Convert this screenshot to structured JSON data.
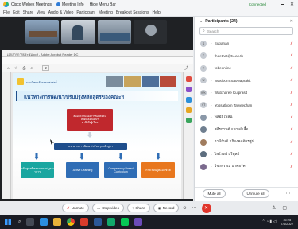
{
  "window": {
    "app_title": "Cisco Webex Meetings",
    "meeting_info": "Meeting Info",
    "hide_menu": "Hide Menu Bar",
    "status": "Connected"
  },
  "menu": [
    "File",
    "Edit",
    "Share",
    "View",
    "Audio & Video",
    "Participant",
    "Meeting",
    "Breakout Sessions",
    "Help"
  ],
  "pdf": {
    "tab_title": "เอกสารการประชุม.pdf - Adobe Acrobat Reader DC",
    "zoom_value": "2"
  },
  "slide": {
    "logo_text": "มหาวิทยาลัยธรรมศาสตร์",
    "heading": "แนวทางการพัฒนา/ปรับปรุงหลักสูตรของคณะฯ",
    "top_box": [
      "สนองความต้องการของสังคม",
      "สอดคล้องแผนฯ",
      "คำนึงถึงผู้เรียน"
    ],
    "middle_bar": "แนวทางการพัฒนา/ปรับปรุงหลักสูตร",
    "bottom_boxes": [
      "หลักสูตรที่หลากหลาย/บูรณาการ",
      "Active Learning",
      "Competency Based Curriculum",
      "การเรียนรู้ตลอดชีวิต"
    ]
  },
  "participants": {
    "title": "Participants (24)",
    "search_placeholder": "Search",
    "list": [
      {
        "initial": "S",
        "name": "Supanan"
      },
      {
        "initial": "T",
        "name": "theethat@tu.ac.th"
      },
      {
        "initial": "T",
        "name": "tobeonline"
      },
      {
        "initial": "W",
        "name": "Wasiporn  Saowaprakit"
      },
      {
        "initial": "WK",
        "name": "Watcharee Kulprasit"
      },
      {
        "initial": "YT",
        "name": "Yossathorn Taweephan"
      },
      {
        "initial": "",
        "name": "พลอยไพลิน"
      },
      {
        "initial": "",
        "name": "ศจีรกานต์ แหวนผีเสื้อ"
      },
      {
        "initial": "",
        "name": "อานีกันต์ อภิมงคลอัครศูน์"
      },
      {
        "initial": "",
        "name": "ไพโรจน์ บรีพูลย์"
      },
      {
        "initial": "",
        "name": "วิชรพรรณ นาคอร์ค"
      }
    ],
    "mute_all": "Mute all",
    "unmute_all": "Unmute all"
  },
  "controls": {
    "unmute": "Unmute",
    "stop_video": "Stop video",
    "share": "Share",
    "record": "Record"
  },
  "taskbar": {
    "time": "16:25",
    "date": "7/4/2022"
  },
  "colors": {
    "slide_dark_blue": "#1f4e8c",
    "slide_red": "#c0282d",
    "box_teal": "#1aa6a0",
    "box_blue": "#2f6db5",
    "box_orange": "#e8771e",
    "end_red": "#e0352b"
  }
}
